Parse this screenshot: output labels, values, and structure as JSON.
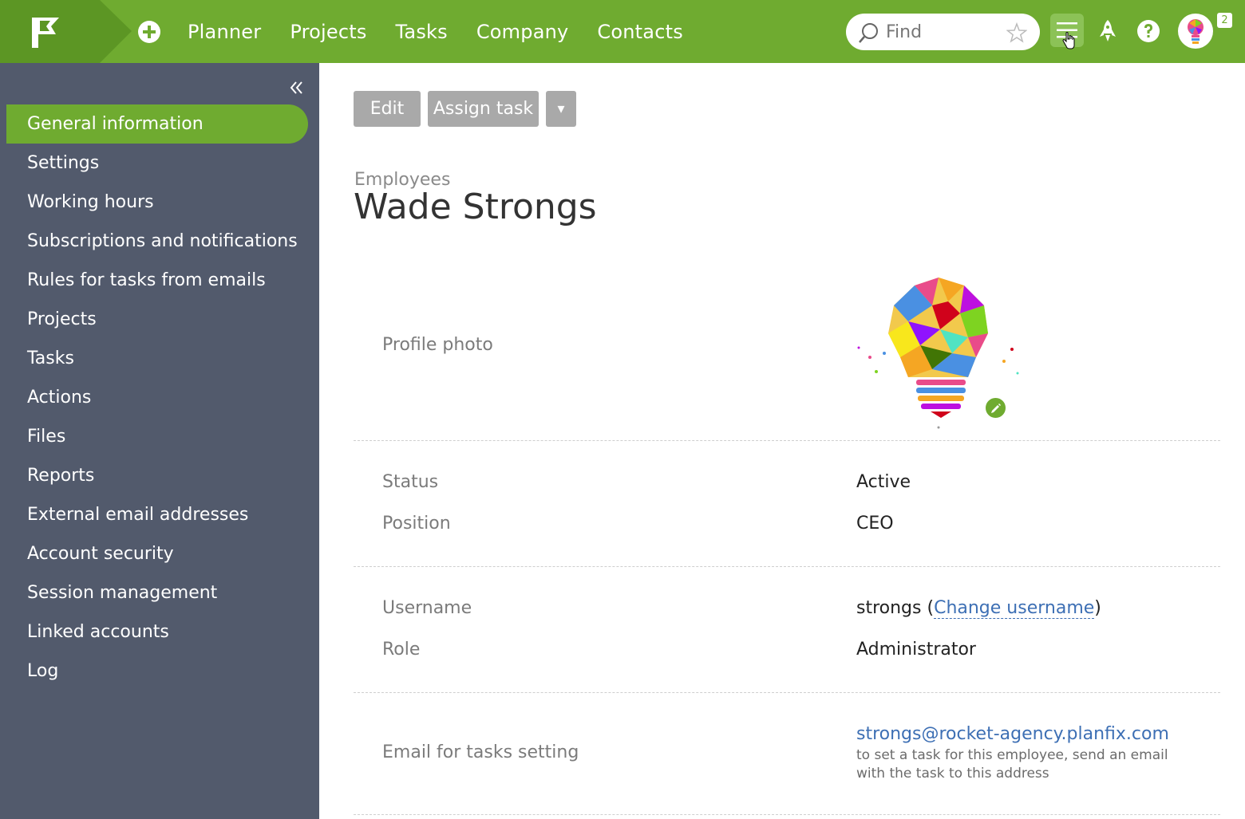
{
  "topbar": {
    "nav": [
      "Planner",
      "Projects",
      "Tasks",
      "Company",
      "Contacts"
    ],
    "search_placeholder": "Find",
    "notification_count": "2",
    "icons": {
      "logo": "flag-logo-icon",
      "add": "plus-circle-icon",
      "search": "search-icon",
      "favorite": "star-icon",
      "menu": "hamburger-menu-icon",
      "launch": "rocket-icon",
      "help": "question-circle-icon"
    },
    "brand_color": "#6fab30"
  },
  "sidebar": {
    "collapse_icon": "double-chevron-left-icon",
    "items": [
      {
        "label": "General information",
        "active": true
      },
      {
        "label": "Settings",
        "active": false
      },
      {
        "label": "Working hours",
        "active": false
      },
      {
        "label": "Subscriptions and notifications",
        "active": false
      },
      {
        "label": "Rules for tasks from emails",
        "active": false
      },
      {
        "label": "Projects",
        "active": false
      },
      {
        "label": "Tasks",
        "active": false
      },
      {
        "label": "Actions",
        "active": false
      },
      {
        "label": "Files",
        "active": false
      },
      {
        "label": "Reports",
        "active": false
      },
      {
        "label": "External email addresses",
        "active": false
      },
      {
        "label": "Account security",
        "active": false
      },
      {
        "label": "Session management",
        "active": false
      },
      {
        "label": "Linked accounts",
        "active": false
      },
      {
        "label": "Log",
        "active": false
      }
    ],
    "background": "#525a6c"
  },
  "toolbar": {
    "edit_label": "Edit",
    "assign_label": "Assign task",
    "more_label": "▾"
  },
  "breadcrumb": "Employees",
  "title": "Wade Strongs",
  "profile": {
    "photo_label": "Profile photo",
    "status_label": "Status",
    "status_value": "Active",
    "position_label": "Position",
    "position_value": "CEO",
    "username_label": "Username",
    "username_value": "strongs",
    "username_paren_open": "(",
    "username_paren_close": ")",
    "change_username": "Change username",
    "role_label": "Role",
    "role_value": "Administrator",
    "email_label": "Email for tasks setting",
    "email_value": "strongs@rocket-agency.planfix.com",
    "email_hint": "to set a task for this employee, send an email with the task to this address"
  }
}
